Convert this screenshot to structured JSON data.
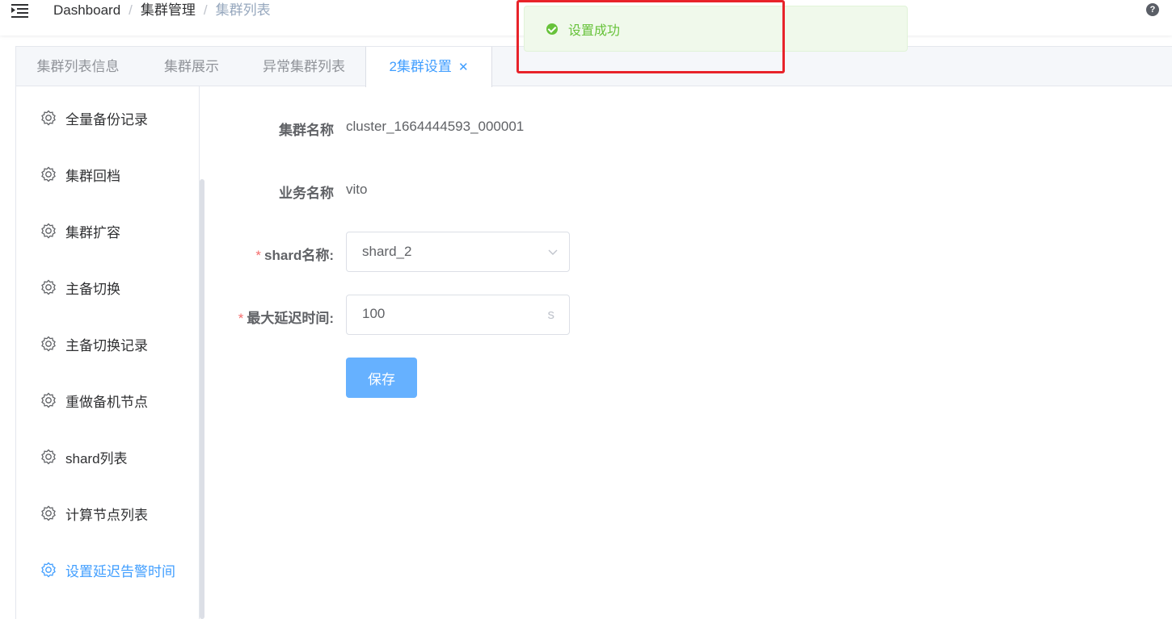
{
  "breadcrumb": [
    "Dashboard",
    "集群管理",
    "集群列表"
  ],
  "toast": {
    "message": "设置成功",
    "color": "#67c23a"
  },
  "tabs": [
    {
      "label": "集群列表信息"
    },
    {
      "label": "集群展示"
    },
    {
      "label": "异常集群列表"
    },
    {
      "label": "2集群设置",
      "active": true
    }
  ],
  "sidebar": {
    "items": [
      {
        "label": "全量备份记录"
      },
      {
        "label": "集群回档"
      },
      {
        "label": "集群扩容"
      },
      {
        "label": "主备切换"
      },
      {
        "label": "主备切换记录"
      },
      {
        "label": "重做备机节点"
      },
      {
        "label": "shard列表"
      },
      {
        "label": "计算节点列表"
      },
      {
        "label": "设置延迟告警时间",
        "active": true
      }
    ]
  },
  "form": {
    "cluster_name_label": "集群名称",
    "cluster_name_value": "cluster_1664444593_000001",
    "business_name_label": "业务名称",
    "business_name_value": "vito",
    "shard_label": "shard名称:",
    "shard_value": "shard_2",
    "max_delay_label": "最大延迟时间:",
    "max_delay_value": "100",
    "max_delay_unit": "s",
    "required_mark": "*",
    "save_label": "保存"
  },
  "colors": {
    "primary": "#409eff",
    "success": "#67c23a",
    "danger": "#f56c6c",
    "highlight": "#e8232a"
  },
  "icons": {
    "sidebar_item": "gear-icon",
    "header_left": "hamburger-icon",
    "header_right": "help-icon"
  }
}
